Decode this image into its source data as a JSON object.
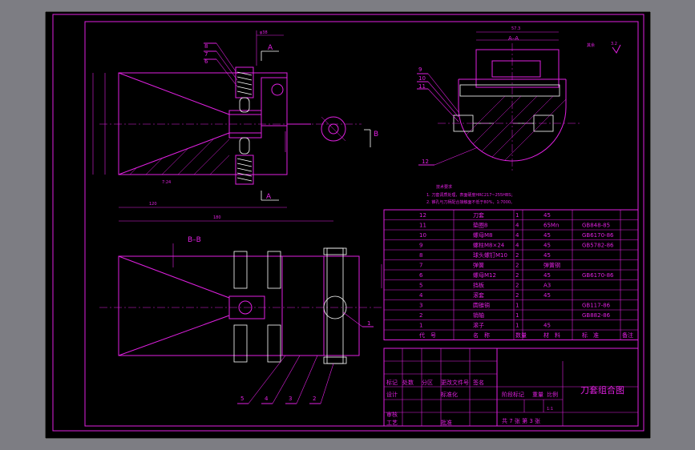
{
  "title_block": {
    "drawing_name": "刀套组合图",
    "row_headers": [
      "标记",
      "处数",
      "分区",
      "更改文件号",
      "签名"
    ],
    "labels": {
      "design": "设计",
      "standard": "标准化",
      "audit": "审核",
      "process": "工艺",
      "approve": "批准"
    },
    "stage_mark": "阶段标记",
    "weight": "重量",
    "scale": "比例",
    "scale_value": "1:1",
    "sheets": "共 7 张 第 3 张"
  },
  "bom": {
    "header": {
      "no": "代　号",
      "name": "名　称",
      "qty": "数量",
      "material": "材　料",
      "standard": "标　准",
      "remark": "备注"
    },
    "rows": [
      {
        "no": "12",
        "name": "刀套",
        "qty": "1",
        "material": "45",
        "std": ""
      },
      {
        "no": "11",
        "name": "垫圈8",
        "qty": "4",
        "material": "65Mn",
        "std": "GB848-85"
      },
      {
        "no": "10",
        "name": "螺母M8",
        "qty": "4",
        "material": "45",
        "std": "GB6170-86"
      },
      {
        "no": "9",
        "name": "螺柱M8×24",
        "qty": "4",
        "material": "45",
        "std": "GB5782-86"
      },
      {
        "no": "8",
        "name": "球头螺钉M10",
        "qty": "2",
        "material": "45",
        "std": ""
      },
      {
        "no": "7",
        "name": "弹簧",
        "qty": "2",
        "material": "弹簧钢",
        "std": ""
      },
      {
        "no": "6",
        "name": "螺母M12",
        "qty": "2",
        "material": "45",
        "std": "GB6170-86"
      },
      {
        "no": "5",
        "name": "挡板",
        "qty": "2",
        "material": "A3",
        "std": ""
      },
      {
        "no": "4",
        "name": "滚套",
        "qty": "2",
        "material": "45",
        "std": ""
      },
      {
        "no": "3",
        "name": "圆锥销",
        "qty": "1",
        "material": "",
        "std": "GB117-86"
      },
      {
        "no": "2",
        "name": "销轴",
        "qty": "1",
        "material": "",
        "std": "GB882-86"
      },
      {
        "no": "1",
        "name": "滚子",
        "qty": "1",
        "material": "45",
        "std": ""
      }
    ]
  },
  "tech_req": {
    "heading": "技术要求",
    "line1": "1. 刀套调质处理，表面硬度HRC217~255HBS；",
    "line2": "2. 锥孔与刀柄配合接触面不低于80%，1:7000。"
  },
  "section_labels": {
    "aa": "A–A",
    "bb": "B–B",
    "a": "A",
    "b": "B"
  },
  "dimensions": {
    "top": "φ38",
    "right": "57.3",
    "roughness": "3.2",
    "rest": "其余",
    "length1": "180",
    "length2": "120",
    "taper": "7:24"
  },
  "balloons": {
    "front": [
      "8",
      "7",
      "6"
    ],
    "aa": [
      "9",
      "10",
      "11",
      "12"
    ],
    "bb": [
      "5",
      "4",
      "3",
      "2",
      "1"
    ]
  },
  "colors": {
    "line": "#e020e0",
    "paper": "#000000",
    "frame": "#7d7d83"
  }
}
